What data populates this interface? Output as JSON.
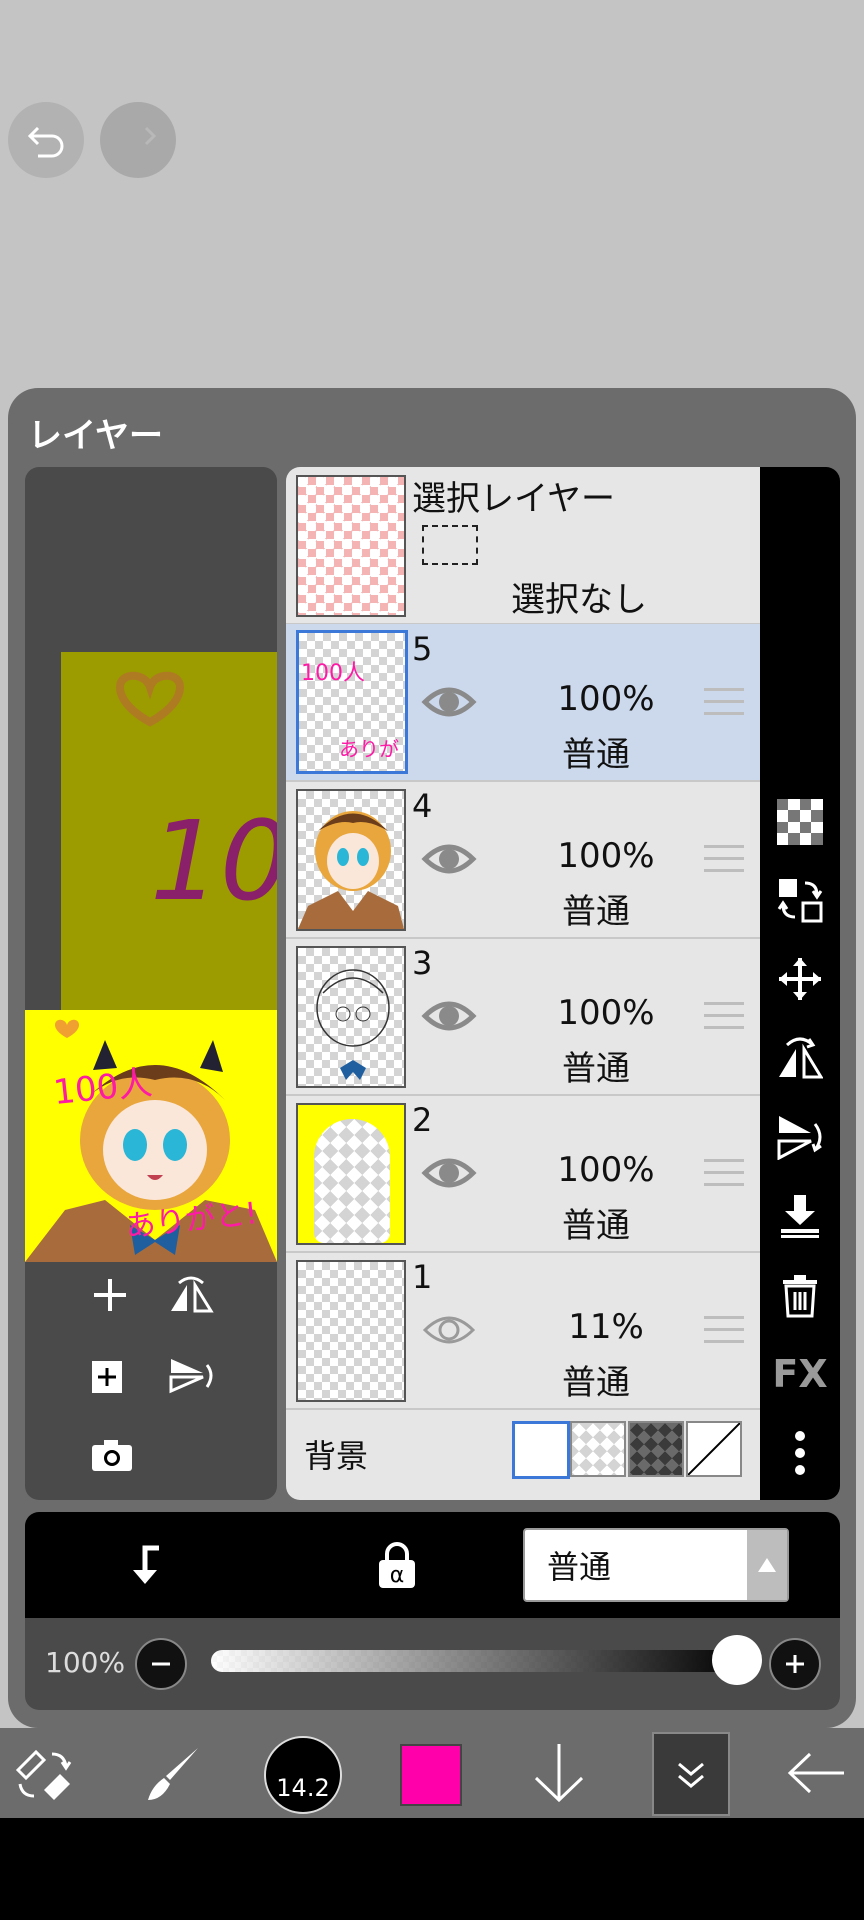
{
  "top_controls": {
    "undo_icon": "undo-icon",
    "redo_icon": "redo-icon"
  },
  "panel": {
    "title": "レイヤー"
  },
  "preview": {
    "thumb_text_1": "100人",
    "thumb_text_2": "ありがと!",
    "canvas_text": "10"
  },
  "selection_layer": {
    "title": "選択レイヤー",
    "status": "選択なし"
  },
  "layers": [
    {
      "number": "5",
      "opacity": "100%",
      "mode": "普通",
      "selected": true,
      "thumb_text_1": "100人",
      "thumb_text_2": "ありが"
    },
    {
      "number": "4",
      "opacity": "100%",
      "mode": "普通",
      "selected": false
    },
    {
      "number": "3",
      "opacity": "100%",
      "mode": "普通",
      "selected": false
    },
    {
      "number": "2",
      "opacity": "100%",
      "mode": "普通",
      "selected": false
    },
    {
      "number": "1",
      "opacity": "11%",
      "mode": "普通",
      "selected": false
    }
  ],
  "background": {
    "label": "背景"
  },
  "right_toolbar": {
    "fx_label": "FX"
  },
  "blend": {
    "mode_value": "普通"
  },
  "opacity": {
    "label": "100%",
    "value": 1.0
  },
  "bottom_toolbar": {
    "brush_size": "14.2",
    "color": "#ff00aa"
  },
  "colors": {
    "accent": "#3c78d8",
    "selected_row": "#ccd9ec",
    "color_swatch": "#ff00aa"
  }
}
